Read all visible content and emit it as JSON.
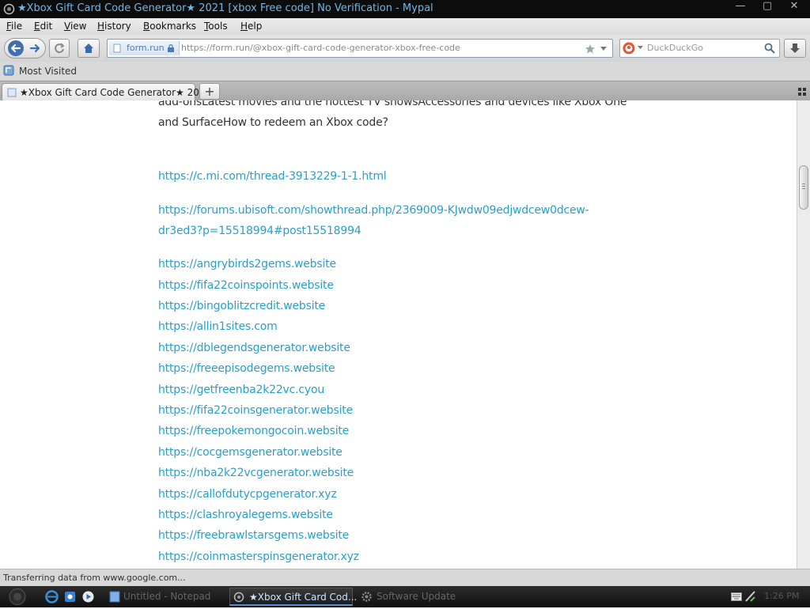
{
  "window": {
    "title": "★Xbox Gift Card Code Generator★ 2021 [xbox Free code] No Verification - Mypal",
    "app_icon": "mypal-logo-icon",
    "controls": [
      "minimize",
      "maximize",
      "close"
    ]
  },
  "menu": {
    "items": [
      {
        "label": "File"
      },
      {
        "label": "Edit"
      },
      {
        "label": "View"
      },
      {
        "label": "History"
      },
      {
        "label": "Bookmarks"
      },
      {
        "label": "Tools"
      },
      {
        "label": "Help"
      }
    ]
  },
  "navbar": {
    "identity_label": "form.run",
    "url": "https://form.run/@xbox-gift-card-code-generator-xbox-free-code",
    "search_engine": "DuckDuckGo",
    "search_placeholder": "DuckDuckGo"
  },
  "bookmarks": {
    "items": [
      {
        "label": "Most Visited"
      }
    ]
  },
  "tabs": {
    "items": [
      {
        "label": "★Xbox Gift Card Code Generator★ 20..."
      }
    ],
    "new_tab": "+"
  },
  "content": {
    "intro_line1": "add-onsLatest movies and the hottest TV showsAccessories and devices like Xbox One",
    "intro_line2": "and SurfaceHow to redeem an Xbox code?",
    "link_group1": [
      "https://c.mi.com/thread-3913229-1-1.html"
    ],
    "link_long": {
      "line1": "https://forums.ubisoft.com/showthread.php/2369009-KJwdw09edjwdcew0dcew-",
      "line2": "dr3ed3?p=15518994#post15518994"
    },
    "links": [
      "https://angrybirds2gems.website",
      "https://fifa22coinspoints.website",
      "https://bingoblitzcredit.website",
      "https://allin1sites.com",
      "https://dblegendsgenerator.website",
      "https://freeepisodegems.website",
      "https://getfreenba2k22vc.cyou",
      "https://fifa22coinsgenerator.website",
      "https://freepokemongocoin.website",
      "https://cocgemsgenerator.website",
      "https://nba2k22vcgenerator.website",
      "https://callofdutycpgenerator.xyz",
      "https://clashroyalegems.website",
      "https://freebrawlstarsgems.website",
      "https://coinmasterspinsgenerator.xyz"
    ]
  },
  "status": {
    "text": "Transferring data from www.google.com..."
  },
  "taskbar": {
    "tasks": [
      {
        "label": "Untitled - Notepad",
        "icon": "notepad-icon"
      },
      {
        "label": "★Xbox Gift Card Cod...",
        "icon": "mypal-icon",
        "active": true
      },
      {
        "label": "Software Update",
        "icon": "update-gear-icon"
      }
    ],
    "clock": "1:26 PM",
    "quick_launch": [
      "ie-icon",
      "explorer-icon",
      "media-player-icon"
    ]
  },
  "colors": {
    "link": "#2a9fc9",
    "title_text": "#6fb7e6",
    "taskbar_active_text": "#cfe6ff"
  }
}
